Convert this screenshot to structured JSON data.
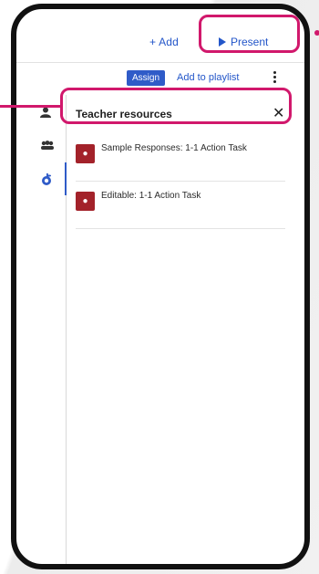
{
  "toolbar": {
    "add_label": "+ Add",
    "present_label": "Present",
    "assign_label": "Assign",
    "playlist_label": "Add to playlist"
  },
  "panel": {
    "title": "Teacher resources",
    "items": [
      {
        "title": "Sample Responses: 1-1 Action Task"
      },
      {
        "title": "Editable: 1-1 Action Task"
      }
    ]
  },
  "icons": [
    "person-icon",
    "group-icon",
    "apple-icon",
    "close-icon",
    "more-icon",
    "play-icon"
  ],
  "colors": {
    "accent": "#2356c9",
    "badge": "#a3222a",
    "highlight": "#d1186c"
  }
}
